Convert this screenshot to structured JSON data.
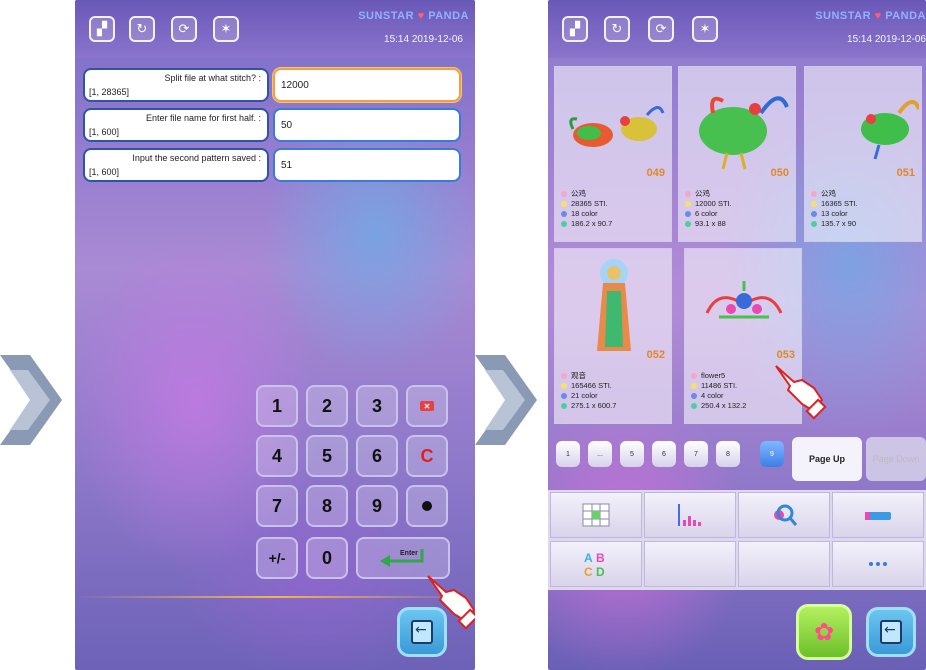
{
  "left_screen": {
    "topbar": {
      "brand": "",
      "clock": "15:14  2019-12-06",
      "icons": [
        "split-icon",
        "rotate-icon",
        "sync-icon",
        "light-icon"
      ]
    },
    "rows": [
      {
        "question": "Split file at what stitch? :",
        "range": "[1, 28365]",
        "value": "12000",
        "active": true
      },
      {
        "question": "Enter file name for first half. :",
        "range": "[1, 600]",
        "value": "50",
        "active": false
      },
      {
        "question": "Input the second pattern saved :",
        "range": "[1, 600]",
        "value": "51",
        "active": false
      }
    ],
    "keypad": {
      "k1": "1",
      "k2": "2",
      "k3": "3",
      "k4": "4",
      "k5": "5",
      "k6": "6",
      "k7": "7",
      "k8": "8",
      "k9": "9",
      "k0": "0",
      "plusminus": "+/-",
      "clear": "C",
      "enter": "Enter"
    }
  },
  "right_screen": {
    "topbar": {
      "brand": "",
      "clock": "15:14  2019-12-06",
      "icons": [
        "split-icon",
        "rotate-icon",
        "sync-icon",
        "light-icon"
      ]
    },
    "patterns": [
      {
        "number": "049",
        "name": "公鸡",
        "stitches": "28365 STI.",
        "colors": "18 color",
        "size": "186.2 x 90.7"
      },
      {
        "number": "050",
        "name": "公鸡",
        "stitches": "12000 STI.",
        "colors": "6 color",
        "size": "93.1 x 88"
      },
      {
        "number": "051",
        "name": "公鸡",
        "stitches": "16365 STI.",
        "colors": "13 color",
        "size": "135.7 x 90"
      },
      {
        "number": "052",
        "name": "观音",
        "stitches": "165466 STI.",
        "colors": "21 color",
        "size": "275.1 x 600.7"
      },
      {
        "number": "053",
        "name": "flower5",
        "stitches": "11486 STI.",
        "colors": "4 color",
        "size": "250.4 x 132.2"
      }
    ],
    "pager": {
      "pages": [
        "1",
        "...",
        "5",
        "6",
        "7",
        "8",
        "9"
      ],
      "page_up": "Page Up",
      "page_down": "Page Down"
    },
    "tools": [
      "grid-select-icon",
      "stitch-chart-icon",
      "search-icon",
      "thread-icon",
      "abcd-letters-icon",
      "",
      "",
      "more-icon"
    ]
  },
  "colors": {
    "accent": "#3c7ad8",
    "number": "#e0882a",
    "clear": "#e02020",
    "enter_arrow": "#2ea84a"
  }
}
